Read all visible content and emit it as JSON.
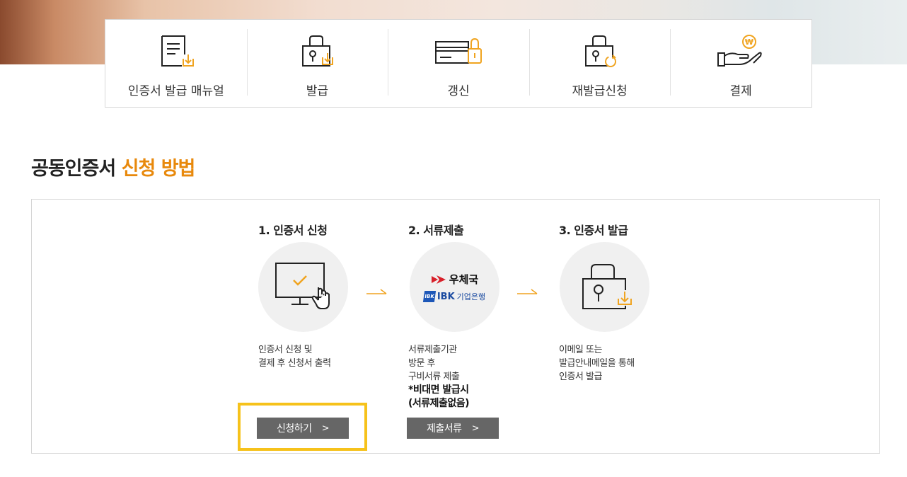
{
  "quick_menu": {
    "items": [
      {
        "label": "인증서 발급 매뉴얼",
        "icon": "manual-download-icon"
      },
      {
        "label": "발급",
        "icon": "lock-download-icon"
      },
      {
        "label": "갱신",
        "icon": "card-lock-icon"
      },
      {
        "label": "재발급신청",
        "icon": "lock-refresh-icon"
      },
      {
        "label": "결제",
        "icon": "hand-coin-icon"
      }
    ]
  },
  "section": {
    "title_plain": "공동인증서 ",
    "title_accent": "신청 방법"
  },
  "steps": [
    {
      "title": "1. 인증서 신청",
      "icon": "monitor-check-icon",
      "desc": [
        "인증서 신청 및",
        "결제 후 신청서 출력"
      ],
      "button": "신청하기"
    },
    {
      "title": "2. 서류제출",
      "icon": "post-ibk-logos",
      "logos": {
        "post": "우체국",
        "ibk_prefix": "IBK",
        "ibk": "기업은행",
        "ibk_box": "IBK"
      },
      "desc": [
        "서류제출기관",
        "방문 후",
        "구비서류 제출"
      ],
      "desc_strong": [
        "*비대면 발급시",
        "(서류제출없음)"
      ],
      "button": "제출서류"
    },
    {
      "title": "3. 인증서 발급",
      "icon": "lock-download-icon",
      "desc": [
        "이메일 또는",
        "발급안내메일을 통해",
        "인증서 발급"
      ]
    }
  ],
  "button_chevron": ">",
  "colors": {
    "accent": "#e8890c",
    "icon_orange": "#f0a420",
    "button_bg": "#666666",
    "highlight": "#f6c21b"
  }
}
